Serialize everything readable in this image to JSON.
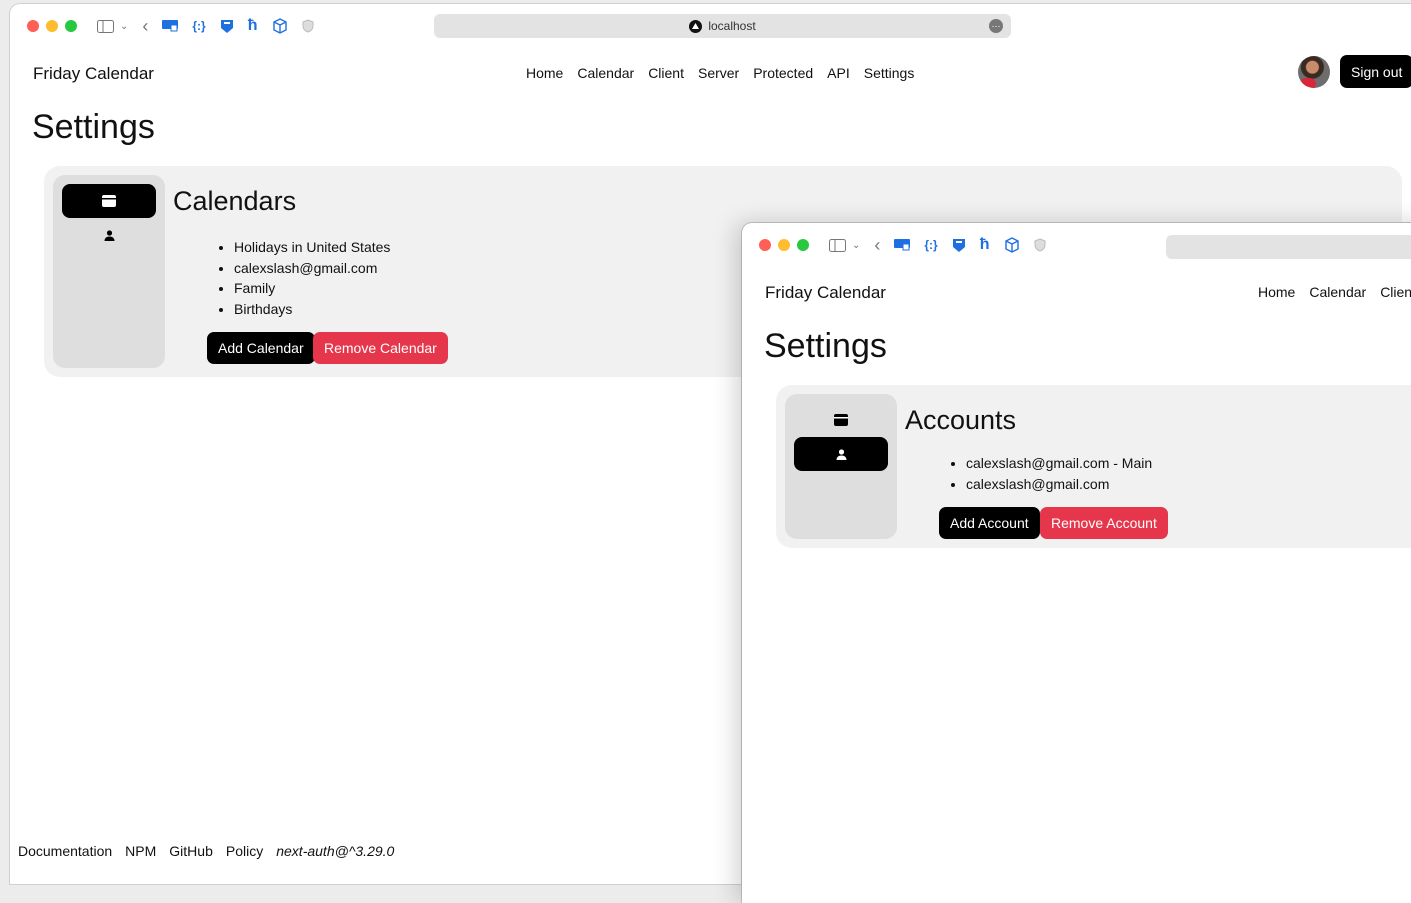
{
  "browser": {
    "url": "localhost"
  },
  "back_window": {
    "nav": {
      "brand": "Friday Calendar",
      "links": [
        "Home",
        "Calendar",
        "Client",
        "Server",
        "Protected",
        "API",
        "Settings"
      ],
      "sign_out": "Sign out"
    },
    "page_title": "Settings",
    "section": {
      "heading": "Calendars",
      "items": [
        "Holidays in United States",
        "calexslash@gmail.com",
        "Family",
        "Birthdays"
      ],
      "add_button": "Add Calendar",
      "remove_button": "Remove Calendar"
    },
    "footer": {
      "links": [
        "Documentation",
        "NPM",
        "GitHub",
        "Policy"
      ],
      "version": "next-auth@^3.29.0"
    }
  },
  "front_window": {
    "nav": {
      "brand": "Friday Calendar",
      "links": [
        "Home",
        "Calendar",
        "Clien"
      ]
    },
    "page_title": "Settings",
    "section": {
      "heading": "Accounts",
      "items": [
        "calexslash@gmail.com - Main",
        "calexslash@gmail.com"
      ],
      "add_button": "Add Account",
      "remove_button": "Remove Account"
    }
  },
  "colors": {
    "accent_dark": "#000000",
    "danger": "#e5364b",
    "card_bg": "#f1f1f1",
    "sidebar_bg": "#dedede"
  },
  "icons": [
    "sidebar-toggle-icon",
    "chevron-down-icon",
    "back-arrow-icon",
    "cast-icon",
    "json-icon",
    "shield-icon",
    "hammer-icon",
    "cube-icon",
    "privacy-shield-icon",
    "calendar-icon",
    "person-icon"
  ]
}
